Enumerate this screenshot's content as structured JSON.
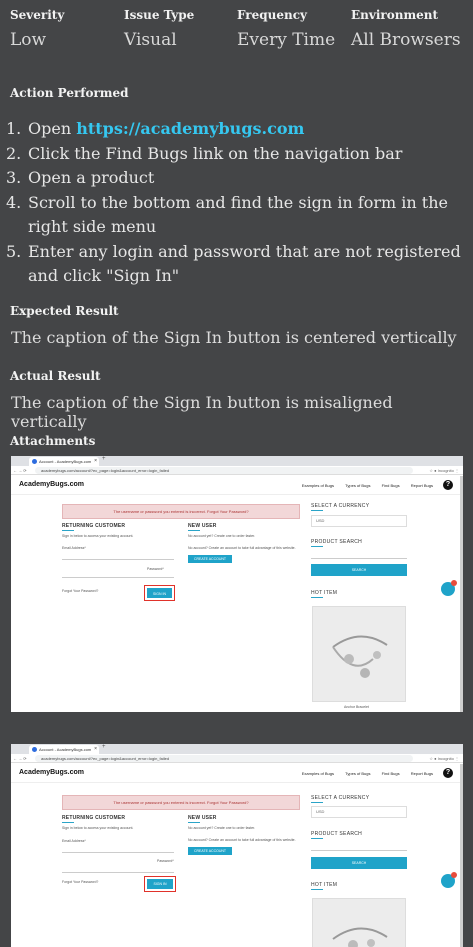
{
  "meta": {
    "headers": [
      "Severity",
      "Issue Type",
      "Frequency",
      "Environment"
    ],
    "values": [
      "Low",
      "Visual",
      "Every Time",
      "All Browsers"
    ]
  },
  "action": {
    "title": "Action Performed",
    "steps": [
      {
        "num": "1.",
        "prefix": "Open ",
        "link": "https://academybugs.com",
        "text": ""
      },
      {
        "num": "2.",
        "prefix": "",
        "link": "",
        "text": "Click the Find Bugs link on the navigation bar"
      },
      {
        "num": "3.",
        "prefix": "",
        "link": "",
        "text": "Open a product"
      },
      {
        "num": "4.",
        "prefix": "",
        "link": "",
        "text": "Scroll to the bottom and find the sign in form in the right side menu"
      },
      {
        "num": "5.",
        "prefix": "",
        "link": "",
        "text": "Enter any login and password that are not registered and click \"Sign In\""
      }
    ]
  },
  "expected": {
    "title": "Expected Result",
    "text": "The caption of the Sign In button is centered vertically"
  },
  "actual": {
    "title": "Actual Result",
    "text": "The caption of the Sign In button is misaligned vertically"
  },
  "attachments": {
    "title": "Attachments",
    "shots": [
      {
        "tab_title": "Account - AcademyBugs.com",
        "url": "academybugs.com/account/?ec_page=login&account_error=login_failed",
        "logo": "AcademyBugs.com",
        "nav": [
          "Examples of Bugs",
          "Types of Bugs",
          "Find Bugs",
          "Report Bugs"
        ],
        "alert": "The username or password you entered is incorrect. Forgot Your Password?",
        "returning": "RETURNING CUSTOMER",
        "returning_sub": "Sign in below to access your existing account.",
        "email_label": "Email Address*",
        "password_label": "Password*",
        "forgot": "Forgot Your Password?",
        "signin": "SIGN IN",
        "new_user": "NEW USER",
        "new_sub": "No account yet? Create one to order faster.",
        "new_sub2": "No account? Create an account to take full advantage of this website.",
        "create": "CREATE ACCOUNT",
        "currency_title": "SELECT A CURRENCY",
        "currency_value": "USD",
        "search_title": "PRODUCT SEARCH",
        "search_btn": "SEARCH",
        "hot_title": "HOT ITEM",
        "hot_caption": "Anchor Bracelet"
      },
      {
        "tab_title": "Account - AcademyBugs.com",
        "url": "academybugs.com/account/?ec_page=login&account_error=login_failed",
        "logo": "AcademyBugs.com",
        "nav": [
          "Examples of Bugs",
          "Types of Bugs",
          "Find Bugs",
          "Report Bugs"
        ],
        "alert": "The username or password you entered is incorrect. Forgot Your Password?",
        "returning": "RETURNING CUSTOMER",
        "returning_sub": "Sign in below to access your existing account.",
        "email_label": "Email Address*",
        "password_label": "Password*",
        "forgot": "Forgot Your Password?",
        "signin": "SIGN IN",
        "new_user": "NEW USER",
        "new_sub": "No account yet? Create one to order faster.",
        "new_sub2": "No account? Create an account to take full advantage of this website.",
        "create": "CREATE ACCOUNT",
        "currency_title": "SELECT A CURRENCY",
        "currency_value": "USD",
        "search_title": "PRODUCT SEARCH",
        "search_btn": "SEARCH",
        "hot_title": "HOT ITEM",
        "hot_caption": ""
      }
    ]
  }
}
